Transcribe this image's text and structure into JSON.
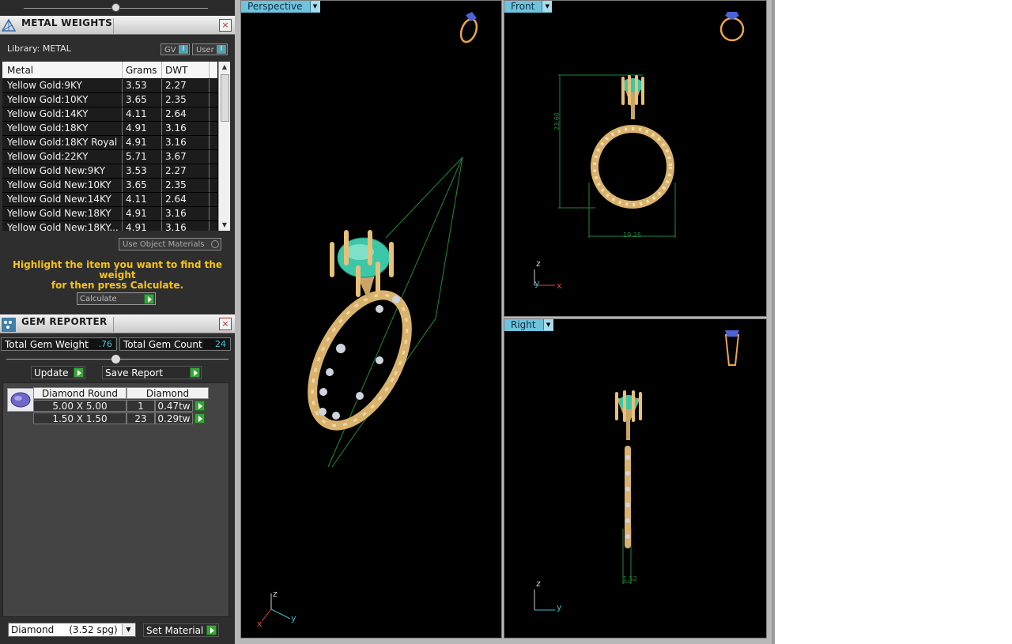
{
  "metal_panel": {
    "title": "METAL WEIGHTS",
    "library_label": "Library: METAL",
    "gv_label": "GV",
    "user_label": "User",
    "toggle_mark": "I",
    "close_glyph": "×",
    "columns": [
      "Metal",
      "Grams",
      "DWT"
    ],
    "rows": [
      [
        "Yellow Gold:9KY",
        "3.53",
        "2.27"
      ],
      [
        "Yellow Gold:10KY",
        "3.65",
        "2.35"
      ],
      [
        "Yellow Gold:14KY",
        "4.11",
        "2.64"
      ],
      [
        "Yellow Gold:18KY",
        "4.91",
        "3.16"
      ],
      [
        "Yellow Gold:18KY Royal",
        "4.91",
        "3.16"
      ],
      [
        "Yellow Gold:22KY",
        "5.71",
        "3.67"
      ],
      [
        "Yellow Gold New:9KY",
        "3.53",
        "2.27"
      ],
      [
        "Yellow Gold New:10KY",
        "3.65",
        "2.35"
      ],
      [
        "Yellow Gold New:14KY",
        "4.11",
        "2.64"
      ],
      [
        "Yellow Gold New:18KY",
        "4.91",
        "3.16"
      ],
      [
        "Yellow Gold New:18KY...",
        "4.91",
        "3.16"
      ]
    ],
    "use_object_materials_label": "Use Object Materials",
    "hint_line1": "Highlight the item you want to find the weight",
    "hint_line2": "for then press Calculate.",
    "calculate_label": "Calculate"
  },
  "gem_panel": {
    "title": "GEM REPORTER",
    "total_weight_label": "Total Gem Weight",
    "total_weight_value": ".76",
    "total_count_label": "Total Gem Count",
    "total_count_value": "24",
    "update_label": "Update",
    "save_report_label": "Save Report",
    "header": [
      "Diamond Round",
      "Diamond"
    ],
    "rows": [
      [
        "5.00 X 5.00",
        "1",
        "0.47tw"
      ],
      [
        "1.50 X 1.50",
        "23",
        "0.29tw"
      ]
    ]
  },
  "material_select": {
    "value": "Diamond     (3.52 spg)"
  },
  "set_material_label": "Set Material",
  "viewports": {
    "perspective": {
      "label": "Perspective"
    },
    "front": {
      "label": "Front",
      "dim_height": "23.60",
      "dim_width": "19.25"
    },
    "right": {
      "label": "Right",
      "dim_width": "1.52"
    }
  },
  "axes": {
    "x": "x",
    "y": "y",
    "z": "z"
  },
  "colors": {
    "accent": "#6ec3dd",
    "gold": "#e8c07a",
    "emerald": "#3cc7a8",
    "hint": "#f7c21b",
    "value": "#3fc7d8",
    "dimension": "#1f8a3a"
  }
}
